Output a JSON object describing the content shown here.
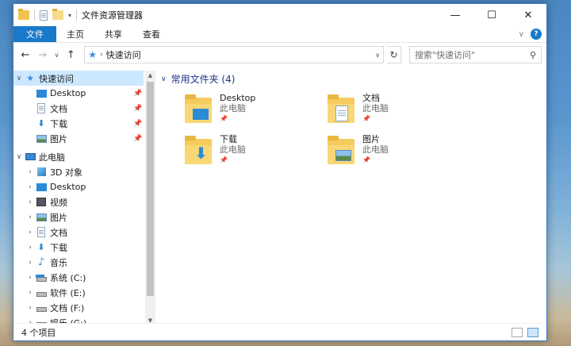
{
  "window": {
    "title": "文件资源管理器",
    "controls": {
      "minimize": "—",
      "maximize": "☐",
      "close": "✕"
    }
  },
  "ribbon": {
    "tabs": [
      {
        "label": "文件",
        "active": true
      },
      {
        "label": "主页"
      },
      {
        "label": "共享"
      },
      {
        "label": "查看"
      }
    ],
    "help": "?"
  },
  "address": {
    "back": "←",
    "forward": "→",
    "recent": "∨",
    "up": "↑",
    "separator": "›",
    "path": "快速访问",
    "dropdown": "∨",
    "refresh": "↻"
  },
  "search": {
    "placeholder": "搜索\"快速访问\""
  },
  "nav": {
    "quick_access": {
      "label": "快速访问",
      "items": [
        {
          "label": "Desktop",
          "icon": "desktop-icon"
        },
        {
          "label": "文档",
          "icon": "document-icon"
        },
        {
          "label": "下载",
          "icon": "download-icon"
        },
        {
          "label": "图片",
          "icon": "picture-icon"
        }
      ]
    },
    "this_pc": {
      "label": "此电脑",
      "items": [
        {
          "label": "3D 对象",
          "icon": "3d-objects-icon"
        },
        {
          "label": "Desktop",
          "icon": "desktop-icon"
        },
        {
          "label": "视频",
          "icon": "video-icon"
        },
        {
          "label": "图片",
          "icon": "picture-icon"
        },
        {
          "label": "文档",
          "icon": "document-icon"
        },
        {
          "label": "下载",
          "icon": "download-icon"
        },
        {
          "label": "音乐",
          "icon": "music-icon"
        },
        {
          "label": "系统 (C:)",
          "icon": "system-drive-icon"
        },
        {
          "label": "软件 (E:)",
          "icon": "drive-icon"
        },
        {
          "label": "文档 (F:)",
          "icon": "drive-icon"
        },
        {
          "label": "娱乐 (G:)",
          "icon": "drive-icon"
        }
      ]
    }
  },
  "content": {
    "group_title": "常用文件夹 (4)",
    "folders": [
      {
        "name": "Desktop",
        "location": "此电脑",
        "icon": "desktop-folder-icon"
      },
      {
        "name": "文档",
        "location": "此电脑",
        "icon": "documents-folder-icon"
      },
      {
        "name": "下载",
        "location": "此电脑",
        "icon": "downloads-folder-icon"
      },
      {
        "name": "图片",
        "location": "此电脑",
        "icon": "pictures-folder-icon"
      }
    ]
  },
  "status": {
    "item_count": "4 个项目"
  },
  "colors": {
    "accent": "#1979ca",
    "selection": "#cce8ff",
    "folder": "#f5cb5c",
    "group_header": "#1e3287"
  }
}
